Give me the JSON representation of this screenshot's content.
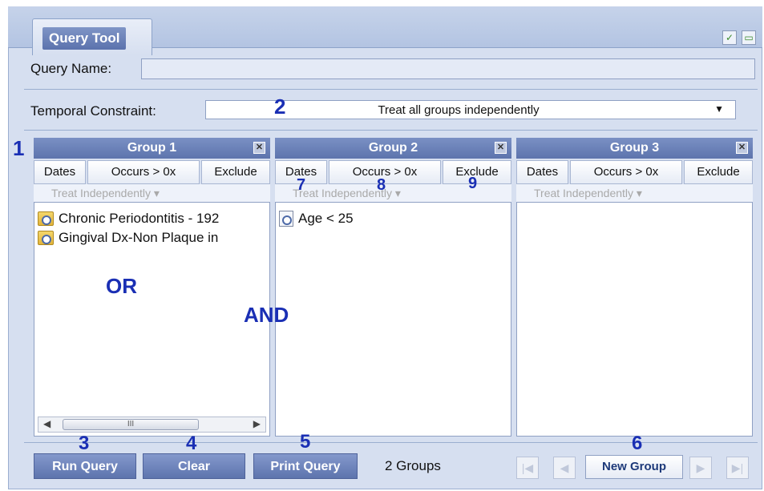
{
  "app": {
    "tab_title": "Query Tool",
    "query_name_label": "Query Name:",
    "query_name_value": "",
    "temporal_label": "Temporal Constraint:",
    "temporal_value": "Treat all groups independently"
  },
  "groups": [
    {
      "title": "Group 1",
      "dates": "Dates",
      "occurs": "Occurs > 0x",
      "exclude": "Exclude",
      "treat": "Treat Independently",
      "items": [
        "Chronic Periodontitis - 192",
        "Gingival Dx-Non Plaque in"
      ]
    },
    {
      "title": "Group 2",
      "dates": "Dates",
      "occurs": "Occurs > 0x",
      "exclude": "Exclude",
      "treat": "Treat Independently",
      "items": [
        "Age < 25"
      ]
    },
    {
      "title": "Group 3",
      "dates": "Dates",
      "occurs": "Occurs > 0x",
      "exclude": "Exclude",
      "treat": "Treat Independently",
      "items": []
    }
  ],
  "scrollbar_thumb": "III",
  "bottom": {
    "run": "Run Query",
    "clear": "Clear",
    "print": "Print Query",
    "count": "2 Groups",
    "new_group": "New Group"
  },
  "annotations": {
    "n1": "1",
    "n2": "2",
    "n3": "3",
    "n4": "4",
    "n5": "5",
    "n6": "6",
    "n7": "7",
    "n8": "8",
    "n9": "9",
    "or": "OR",
    "and": "AND"
  }
}
